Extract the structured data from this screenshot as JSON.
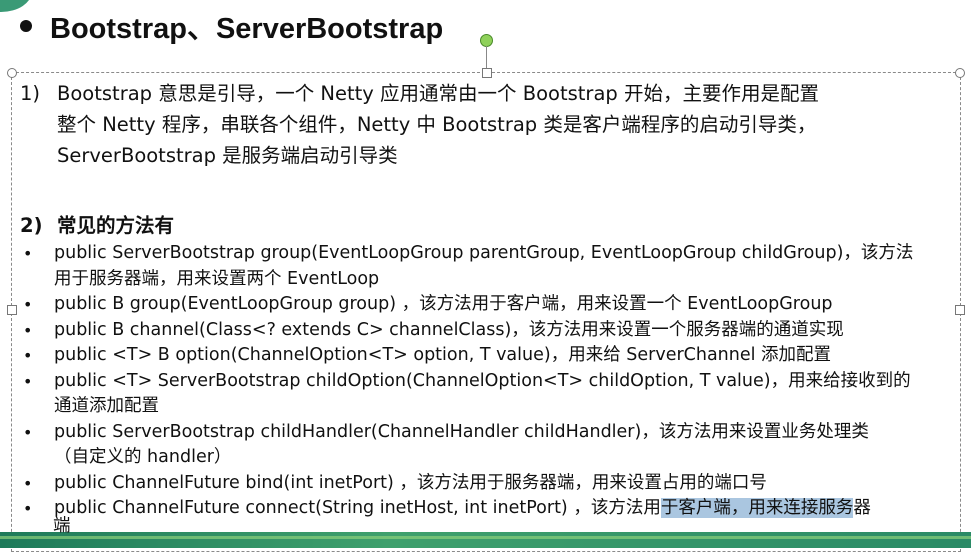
{
  "slide": {
    "title": "Bootstrap、ServerBootstrap",
    "para1": {
      "num": "1)",
      "lines": [
        "Bootstrap 意思是引导，一个 Netty 应用通常由一个 Bootstrap 开始，主要作用是配置",
        "整个 Netty 程序，串联各个组件，Netty 中 Bootstrap 类是客户端程序的启动引导类，",
        "ServerBootstrap 是服务端启动引导类"
      ]
    },
    "section2": {
      "num": "2)",
      "title": "常见的方法有"
    },
    "methods": [
      {
        "bullet": "•",
        "lines": [
          "public ServerBootstrap group(EventLoopGroup parentGroup, EventLoopGroup childGroup)，该方法",
          "用于服务器端，用来设置两个 EventLoop"
        ]
      },
      {
        "bullet": "•",
        "lines": [
          "public B group(EventLoopGroup group) ，该方法用于客户端，用来设置一个 EventLoopGroup"
        ]
      },
      {
        "bullet": "•",
        "lines": [
          "public B channel(Class<? extends C> channelClass)，该方法用来设置一个服务器端的通道实现"
        ]
      },
      {
        "bullet": "•",
        "lines": [
          "public <T> B option(ChannelOption<T> option, T value)，用来给 ServerChannel 添加配置"
        ]
      },
      {
        "bullet": "•",
        "lines": [
          "public <T> ServerBootstrap childOption(ChannelOption<T> childOption, T value)，用来给接收到的",
          "通道添加配置"
        ]
      },
      {
        "bullet": "•",
        "lines": [
          "public ServerBootstrap childHandler(ChannelHandler  childHandler)，该方法用来设置业务处理类",
          "（自定义的 handler）"
        ]
      },
      {
        "bullet": "•",
        "lines": [
          "public ChannelFuture bind(int inetPort) ，该方法用于服务器端，用来设置占用的端口号"
        ]
      }
    ],
    "last_method": {
      "bullet": "•",
      "before": "public ChannelFuture connect(String inetHost, int inetPort) ，该方法用",
      "selected": "于客户端，用来连接服务",
      "after": "器",
      "overflow": "端"
    }
  }
}
